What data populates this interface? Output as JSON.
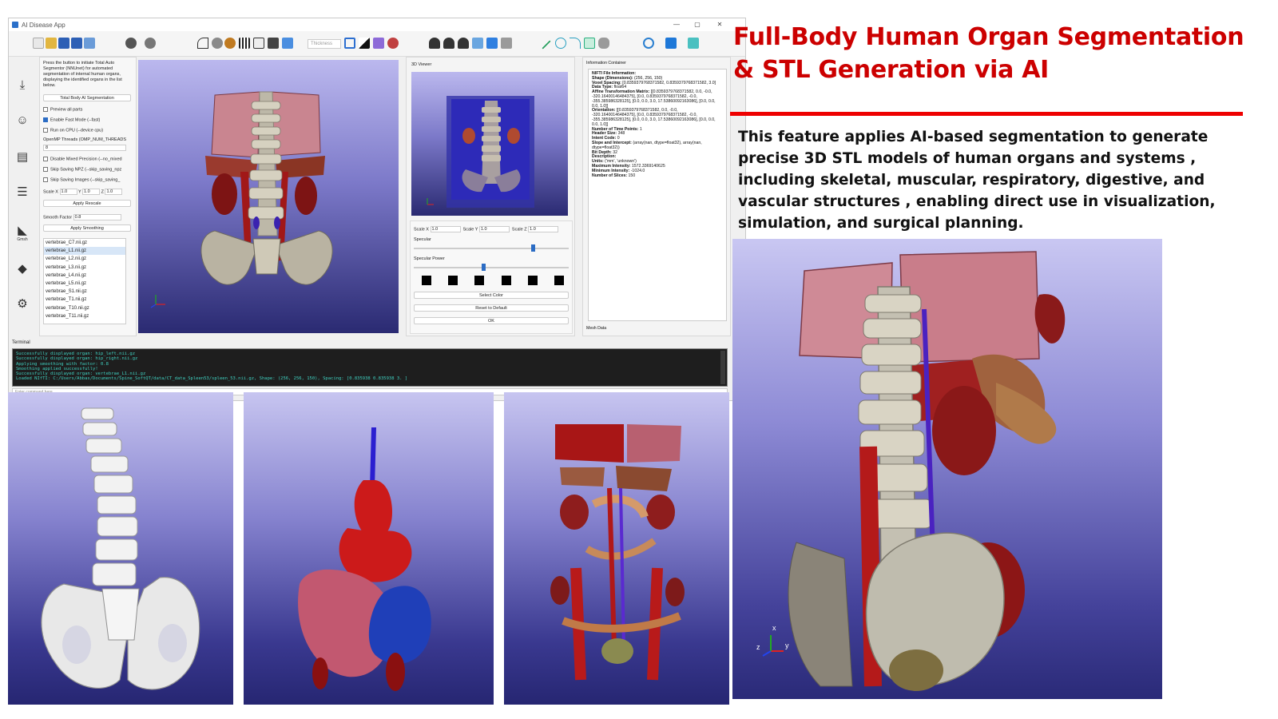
{
  "window": {
    "title": "AI Disease App",
    "controls": [
      "—",
      "▢",
      "✕"
    ]
  },
  "toolbar": {
    "thickness_placeholder": "Thickness"
  },
  "left_rail": {
    "gmsh_label": "Gmsh"
  },
  "side_panel": {
    "intro_text": "Press the button to initiate Total Auto Segmentor (NNUnet) for automated segmentation of internal human organs, displaying the identified organs in the list below.",
    "segment_button": "Total Body AI Segmentation",
    "preview_all": "Preview all parts",
    "enable_fast": "Enable Fast Mode (--fast)",
    "run_cpu": "Run on CPU (--device cpu)",
    "omp_label": "OpenMP Threads (OMP_NUM_THREADS",
    "omp_value": "8",
    "disable_mixed": "Disable Mixed Precision (--no_mixed",
    "skip_npz": "Skip Saving NPZ (--skip_saving_npz",
    "skip_images": "Skip Saving Images (--skip_saving_",
    "scale_x_label": "Scale X",
    "scale_x": "1.0",
    "scale_y_label": "Y",
    "scale_y": "1.0",
    "scale_z_label": "Z",
    "scale_z": "1.0",
    "apply_rescale": "Apply Rescale",
    "smooth_label": "Smooth Factor",
    "smooth_value": "0.8",
    "apply_smoothing": "Apply Smoothing",
    "organs": [
      "vertebrae_C7.nii.gz",
      "vertebrae_L1.nii.gz",
      "vertebrae_L2.nii.gz",
      "vertebrae_L3.nii.gz",
      "vertebrae_L4.nii.gz",
      "vertebrae_L5.nii.gz",
      "vertebrae_S1.nii.gz",
      "vertebrae_T1.nii.gz",
      "vertebrae_T10.nii.gz",
      "vertebrae_T11.nii.gz"
    ],
    "selected_organ": "vertebrae_L1.nii.gz"
  },
  "viewer": {
    "title": "3D Viewer",
    "scale_x_label": "Scale X",
    "scale_x": "1.0",
    "scale_y_label": "Scale Y",
    "scale_y": "1.0",
    "scale_z_label": "Scale Z",
    "scale_z": "1.0",
    "specular_label": "Specular",
    "specular_value": 0.78,
    "specular_power_label": "Specular Power",
    "specular_power_value": 0.45,
    "select_color": "Select Color",
    "reset_default": "Reset to Default",
    "ok": "OK"
  },
  "info": {
    "title": "Information Container",
    "heading": "NIFTI File Information:",
    "rows": [
      [
        "Shape (Dimensions):",
        "(256, 256, 150)"
      ],
      [
        "Voxel Spacing:",
        "[0.8359379768371582, 0.8359379768371582, 3.0]"
      ],
      [
        "Data Type:",
        "float64"
      ],
      [
        "Affine Transformation Matrix:",
        "[[0.8359379768371582, 0.0, -0.0, -320.16400146484375], [0.0, 0.8359379768371582, -0.0, -355.385986328125], [0.0, 0.0, 3.0, 17.53860092163086], [0.0, 0.0, 0.0, 1.0]]"
      ],
      [
        "Orientation:",
        "[[0.8359379768371582, 0.0, -0.0, -320.16400146484375], [0.0, 0.8359379768371582, -0.0, -355.385986328125], [0.0, 0.0, 3.0, 17.53860092163086], [0.0, 0.0, 0.0, 1.0]]"
      ],
      [
        "Number of Time Points:",
        "1"
      ],
      [
        "Header Size:",
        "348"
      ],
      [
        "Intent Code:",
        "0"
      ],
      [
        "Slope and Intercept:",
        "(array(nan, dtype=float32), array(nan, dtype=float32))"
      ],
      [
        "Bit Depth:",
        "32"
      ],
      [
        "Description:",
        ""
      ],
      [
        "Units:",
        "('mm', 'unknown')"
      ],
      [
        "Maximum Intensity:",
        "1572.3369140625"
      ],
      [
        "Minimum Intensity:",
        "-1024.0"
      ],
      [
        "Number of Slices:",
        "150"
      ]
    ],
    "mesh_data": "Mesh Data"
  },
  "terminal": {
    "label": "Terminal",
    "lines": [
      "Successfully displayed organ: hip_left.nii.gz",
      "Successfully displayed organ: hip_right.nii.gz",
      "Applying smoothing with factor: 0.8",
      "Smoothing applied successfully!",
      "Successfully displayed organ: vertebrae_L1.nii.gz",
      "Loaded NIfTI: C:/Users/Abbas/Documents/Spine_SoftQT/data/CT_data_Spleen53/spleen_53.nii.gz, Shape: (256, 256, 150), Spacing: [0.835938 0.835938 3. ]"
    ],
    "input_placeholder": "Enter command here..."
  },
  "headline": {
    "line1": "Full-Body Human Organ Segmentation",
    "line2": "& STL Generation via AI"
  },
  "description": "This feature applies AI-based segmentation to generate precise 3D STL models of human organs and systems , including skeletal, muscular, respiratory, digestive, and vascular structures , enabling direct use in visualization, simulation, and surgical planning.",
  "axes": {
    "x": "x",
    "y": "y",
    "z": "z"
  },
  "colors": {
    "headline": "#cc0000",
    "rule": "#ee0000",
    "bone": "#c9c4b4",
    "muscle": "#a41414",
    "liver": "#c86470",
    "spleen": "#2040b0",
    "vessel": "#4020c0",
    "viewport_top": "#c7c5f0",
    "viewport_bottom": "#262672"
  }
}
